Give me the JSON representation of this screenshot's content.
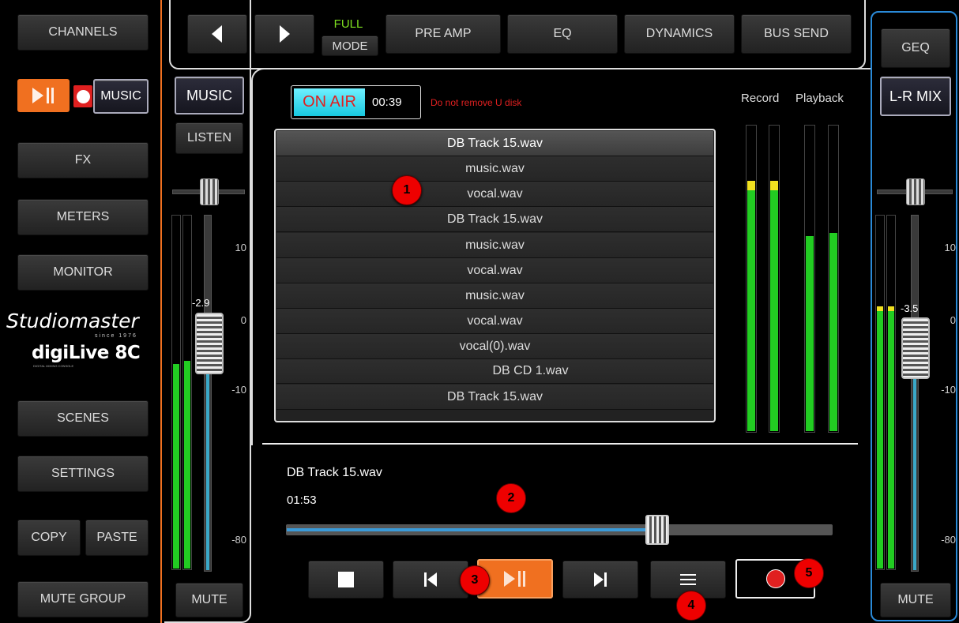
{
  "nav": {
    "channels": "CHANNELS",
    "music": "MUSIC",
    "fx": "FX",
    "meters": "METERS",
    "monitor": "MONITOR",
    "scenes": "SCENES",
    "settings": "SETTINGS",
    "copy": "COPY",
    "paste": "PASTE",
    "mute_group": "MUTE GROUP"
  },
  "logo": {
    "brand": "Studiomaster",
    "since": "since 1976",
    "product": "digiLive 8C",
    "product_sub": "DIGITAL MIXING CONSOLE"
  },
  "topbar": {
    "mode_top": "FULL",
    "mode_bottom": "MODE",
    "preamp": "PRE AMP",
    "eq": "EQ",
    "dynamics": "DYNAMICS",
    "bus_send": "BUS SEND"
  },
  "right_panel": {
    "geq": "GEQ",
    "lr_mix": "L-R MIX",
    "mute": "MUTE",
    "fader_value": "-3.5",
    "scale": [
      "10",
      "0",
      "-10",
      "-80"
    ]
  },
  "left_channel": {
    "name": "MUSIC",
    "listen": "LISTEN",
    "mute": "MUTE",
    "fader_value": "-2.9",
    "scale": [
      "10",
      "0",
      "-10",
      "-80"
    ]
  },
  "status": {
    "on_air": "ON AIR",
    "time": "00:39",
    "warning": "Do not remove U disk"
  },
  "meters_labels": {
    "record": "Record",
    "playback": "Playback"
  },
  "tracks": [
    "DB Track 15.wav",
    "music.wav",
    "vocal.wav",
    "DB Track 15.wav",
    "music.wav",
    "vocal.wav",
    "music.wav",
    "vocal.wav",
    "vocal(0).wav",
    "DB CD 1.wav",
    "DB Track 15.wav"
  ],
  "player": {
    "current_track": "DB Track 15.wav",
    "elapsed": "01:53",
    "progress": 0.68
  },
  "badges": [
    "1",
    "2",
    "3",
    "4",
    "5"
  ],
  "levels": {
    "record_l": 0.79,
    "record_r": 0.79,
    "playback_l": 0.64,
    "playback_r": 0.65,
    "left_ch_l": 0.58,
    "left_ch_r": 0.59,
    "lr_l": 0.73,
    "lr_r": 0.73
  },
  "colors": {
    "accent_orange": "#f07020",
    "meter_green": "#22cc22",
    "on_air_cyan": "#2fd8e8",
    "warning_red": "#e02020",
    "lr_border_blue": "#2a8ad8"
  },
  "icons": {
    "prev": "triangle-left-icon",
    "next": "triangle-right-icon",
    "stop": "stop-icon",
    "skip_back": "skip-back-icon",
    "play_pause": "play-pause-icon",
    "skip_forward": "skip-forward-icon",
    "menu": "menu-icon",
    "record": "record-icon"
  }
}
